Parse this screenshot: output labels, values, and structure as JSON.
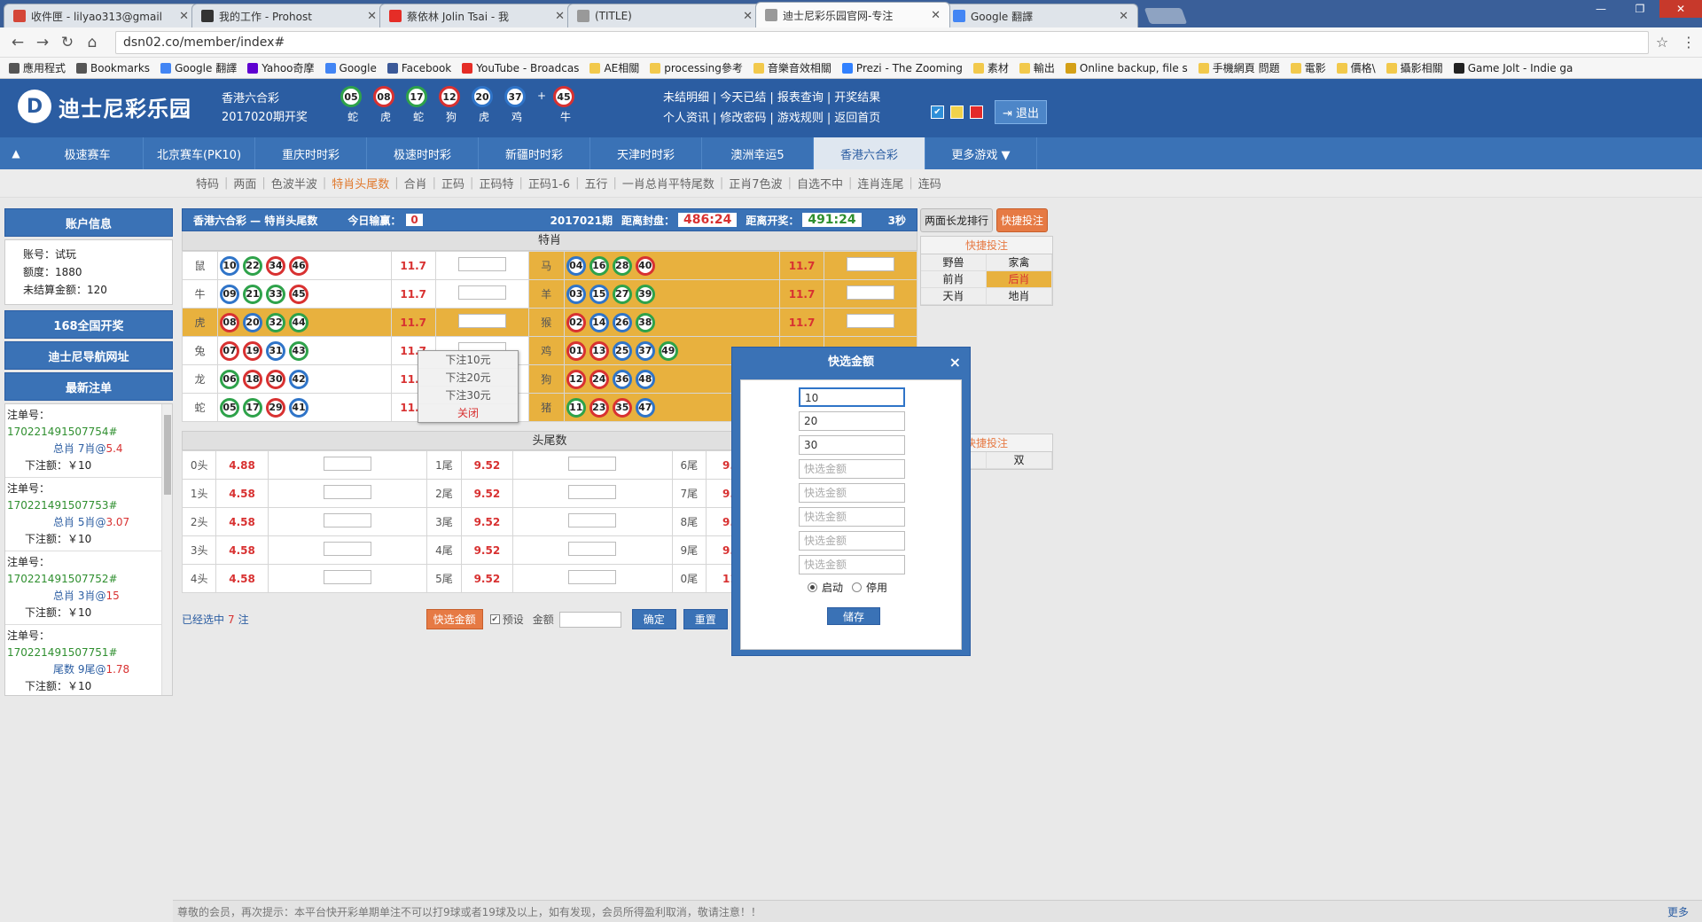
{
  "browser": {
    "tabs": [
      {
        "title": "收件匣 - lilyao313@gmail",
        "icon": "gmail-icon",
        "color": "#d44638",
        "active": false
      },
      {
        "title": "我的工作 - Prohost",
        "icon": "github-icon",
        "color": "#333333",
        "active": false
      },
      {
        "title": "蔡依林 Jolin Tsai - 我",
        "icon": "youtube-icon",
        "color": "#e52d27",
        "active": false
      },
      {
        "title": "(TITLE)",
        "icon": "page-icon",
        "color": "#999999",
        "active": false
      },
      {
        "title": "迪士尼彩乐园官网-专注",
        "icon": "page-icon",
        "color": "#999999",
        "active": true
      },
      {
        "title": "Google 翻譯",
        "icon": "google-translate-icon",
        "color": "#4285f4",
        "active": false
      }
    ],
    "url": "dsn02.co/member/index#",
    "bookmarks": [
      {
        "label": "應用程式",
        "icon": "apps-icon",
        "color": "#555555"
      },
      {
        "label": "Bookmarks",
        "icon": "star-icon",
        "color": "#555555"
      },
      {
        "label": "Google 翻譯",
        "icon": "google-translate-icon",
        "color": "#4285f4"
      },
      {
        "label": "Yahoo奇摩",
        "icon": "yahoo-icon",
        "color": "#5f01d1"
      },
      {
        "label": "Google",
        "icon": "google-icon",
        "color": "#4285f4"
      },
      {
        "label": "Facebook",
        "icon": "facebook-icon",
        "color": "#3b5998"
      },
      {
        "label": "YouTube - Broadcas",
        "icon": "youtube-icon",
        "color": "#e52d27"
      },
      {
        "label": "AE相關",
        "icon": "folder-icon",
        "color": "#f2c94c"
      },
      {
        "label": "processing參考",
        "icon": "folder-icon",
        "color": "#f2c94c"
      },
      {
        "label": "音樂音效相關",
        "icon": "folder-icon",
        "color": "#f2c94c"
      },
      {
        "label": "Prezi - The Zooming",
        "icon": "prezi-icon",
        "color": "#3181ff"
      },
      {
        "label": "素材",
        "icon": "folder-icon",
        "color": "#f2c94c"
      },
      {
        "label": "輸出",
        "icon": "folder-icon",
        "color": "#f2c94c"
      },
      {
        "label": "Online backup, file s",
        "icon": "backup-icon",
        "color": "#d4a017"
      },
      {
        "label": "手機網頁 問題",
        "icon": "folder-icon",
        "color": "#f2c94c"
      },
      {
        "label": "電影",
        "icon": "folder-icon",
        "color": "#f2c94c"
      },
      {
        "label": "價格\\",
        "icon": "folder-icon",
        "color": "#f2c94c"
      },
      {
        "label": "攝影相關",
        "icon": "folder-icon",
        "color": "#f2c94c"
      },
      {
        "label": "Game Jolt - Indie ga",
        "icon": "gamejolt-icon",
        "color": "#222222"
      }
    ]
  },
  "header": {
    "logo_letter": "D",
    "site_name": "迪士尼彩乐园",
    "lottery": "香港六合彩",
    "period_label": "2017020期开奖",
    "draw_balls": [
      {
        "num": "05",
        "zodiac": "蛇",
        "color": "green"
      },
      {
        "num": "08",
        "zodiac": "虎",
        "color": "red"
      },
      {
        "num": "17",
        "zodiac": "蛇",
        "color": "green"
      },
      {
        "num": "12",
        "zodiac": "狗",
        "color": "red"
      },
      {
        "num": "20",
        "zodiac": "虎",
        "color": "blue"
      },
      {
        "num": "37",
        "zodiac": "鸡",
        "color": "blue"
      }
    ],
    "plus": "+",
    "special_ball": {
      "num": "45",
      "zodiac": "牛",
      "color": "red"
    },
    "links_row1": [
      "未结明细",
      "今天已结",
      "报表查询",
      "开奖结果"
    ],
    "links_row2": [
      "个人资讯",
      "修改密码",
      "游戏规则",
      "返回首页"
    ],
    "link_sep": "|",
    "theme_colors": [
      "#2f8fd8",
      "#f2d24b",
      "#e32a2a"
    ],
    "logout": "退出"
  },
  "main_nav": {
    "toggle": "▲",
    "items": [
      "极速赛车",
      "北京赛车(PK10)",
      "重庆时时彩",
      "极速时时彩",
      "新疆时时彩",
      "天津时时彩",
      "澳洲幸运5",
      "香港六合彩",
      "更多游戏 ▼"
    ],
    "active_index": 7
  },
  "sub_nav": {
    "items": [
      "特码",
      "两面",
      "色波半波",
      "特肖头尾数",
      "合肖",
      "正码",
      "正码特",
      "正码1-6",
      "五行",
      "一肖总肖平特尾数",
      "正肖7色波",
      "自选不中",
      "连肖连尾",
      "连码"
    ],
    "active_index": 3,
    "sep": "|"
  },
  "sidebar": {
    "account_title": "账户信息",
    "account_lines": [
      "账号：试玩",
      "额度：1880",
      "未结算金额：120"
    ],
    "link1": "168全国开奖",
    "link2": "迪士尼导航网址",
    "recent_title": "最新注单",
    "bets": [
      {
        "label": "注单号：",
        "num": "170221491507754#",
        "detail": "总肖 7肖@",
        "odds": "5.4",
        "amount": "下注额：￥10"
      },
      {
        "label": "注单号：",
        "num": "170221491507753#",
        "detail": "总肖 5肖@",
        "odds": "3.07",
        "amount": "下注额：￥10"
      },
      {
        "label": "注单号：",
        "num": "170221491507752#",
        "detail": "总肖 3肖@",
        "odds": "15",
        "amount": "下注额：￥10"
      },
      {
        "label": "注单号：",
        "num": "170221491507751#",
        "detail": "尾数 9尾@",
        "odds": "1.78",
        "amount": "下注额：￥10"
      }
    ]
  },
  "content": {
    "title": "香港六合彩 — 特肖头尾数",
    "today_label": "今日输赢：",
    "today_value": "0",
    "period": "2017021期",
    "close_label": "距离封盘：",
    "close_time": "486:24",
    "open_label": "距离开奖：",
    "open_time": "491:24",
    "refresh": "3秒",
    "zodiac_header": "特肖",
    "zodiac_left": [
      {
        "name": "鼠",
        "balls": [
          [
            "10",
            "blue"
          ],
          [
            "22",
            "green"
          ],
          [
            "34",
            "red"
          ],
          [
            "46",
            "red"
          ]
        ],
        "odds": "11.7",
        "selected": false
      },
      {
        "name": "牛",
        "balls": [
          [
            "09",
            "blue"
          ],
          [
            "21",
            "green"
          ],
          [
            "33",
            "green"
          ],
          [
            "45",
            "red"
          ]
        ],
        "odds": "11.7",
        "selected": false
      },
      {
        "name": "虎",
        "balls": [
          [
            "08",
            "red"
          ],
          [
            "20",
            "blue"
          ],
          [
            "32",
            "green"
          ],
          [
            "44",
            "green"
          ]
        ],
        "odds": "11.7",
        "selected": true
      },
      {
        "name": "兔",
        "balls": [
          [
            "07",
            "red"
          ],
          [
            "19",
            "red"
          ],
          [
            "31",
            "blue"
          ],
          [
            "43",
            "green"
          ]
        ],
        "odds": "11.7",
        "selected": false
      },
      {
        "name": "龙",
        "balls": [
          [
            "06",
            "green"
          ],
          [
            "18",
            "red"
          ],
          [
            "30",
            "red"
          ],
          [
            "42",
            "blue"
          ]
        ],
        "odds": "11.7",
        "selected": false
      },
      {
        "name": "蛇",
        "balls": [
          [
            "05",
            "green"
          ],
          [
            "17",
            "green"
          ],
          [
            "29",
            "red"
          ],
          [
            "41",
            "blue"
          ]
        ],
        "odds": "11.7",
        "selected": false
      }
    ],
    "zodiac_right": [
      {
        "name": "马",
        "balls": [
          [
            "04",
            "blue"
          ],
          [
            "16",
            "green"
          ],
          [
            "28",
            "green"
          ],
          [
            "40",
            "red"
          ]
        ],
        "odds": "11.7"
      },
      {
        "name": "羊",
        "balls": [
          [
            "03",
            "blue"
          ],
          [
            "15",
            "blue"
          ],
          [
            "27",
            "green"
          ],
          [
            "39",
            "green"
          ]
        ],
        "odds": "11.7"
      },
      {
        "name": "猴",
        "balls": [
          [
            "02",
            "red"
          ],
          [
            "14",
            "blue"
          ],
          [
            "26",
            "blue"
          ],
          [
            "38",
            "green"
          ]
        ],
        "odds": "11.7"
      },
      {
        "name": "鸡",
        "balls": [
          [
            "01",
            "red"
          ],
          [
            "13",
            "red"
          ],
          [
            "25",
            "blue"
          ],
          [
            "37",
            "blue"
          ],
          [
            "49",
            "green"
          ]
        ],
        "odds": ""
      },
      {
        "name": "狗",
        "balls": [
          [
            "12",
            "red"
          ],
          [
            "24",
            "red"
          ],
          [
            "36",
            "blue"
          ],
          [
            "48",
            "blue"
          ]
        ],
        "odds": ""
      },
      {
        "name": "猪",
        "balls": [
          [
            "11",
            "green"
          ],
          [
            "23",
            "red"
          ],
          [
            "35",
            "red"
          ],
          [
            "47",
            "blue"
          ]
        ],
        "odds": ""
      }
    ],
    "tw_header": "头尾数",
    "tw_rows": [
      [
        {
          "l": "0头",
          "o": "4.88"
        },
        {
          "l": "1尾",
          "o": "9.52"
        },
        {
          "l": "6尾",
          "o": "9.5"
        }
      ],
      [
        {
          "l": "1头",
          "o": "4.58"
        },
        {
          "l": "2尾",
          "o": "9.52"
        },
        {
          "l": "7尾",
          "o": "9.5"
        }
      ],
      [
        {
          "l": "2头",
          "o": "4.58"
        },
        {
          "l": "3尾",
          "o": "9.52"
        },
        {
          "l": "8尾",
          "o": "9.5"
        }
      ],
      [
        {
          "l": "3头",
          "o": "4.58"
        },
        {
          "l": "4尾",
          "o": "9.52"
        },
        {
          "l": "9尾",
          "o": "9.5"
        }
      ],
      [
        {
          "l": "4头",
          "o": "4.58"
        },
        {
          "l": "5尾",
          "o": "9.52"
        },
        {
          "l": "0尾",
          "o": "11."
        }
      ]
    ],
    "selected_pre": "已经选中",
    "selected_count": "7",
    "selected_post": "注",
    "quick_btn": "快选金额",
    "preset_check": "✔",
    "preset_label": "预设",
    "amount_label": "金额",
    "confirm": "确定",
    "reset": "重置"
  },
  "dropdown": {
    "items": [
      "下注10元",
      "下注20元",
      "下注30元"
    ],
    "close": "关闭"
  },
  "right_panel": {
    "tab1": "两面长龙排行",
    "tab2": "快捷投注",
    "quick_title": "快捷投注",
    "rows": [
      [
        "野兽",
        "家禽"
      ],
      [
        "前肖",
        "后肖"
      ],
      [
        "天肖",
        "地肖"
      ]
    ],
    "active": "后肖",
    "quick_title2": "快捷投注",
    "row2_right": "双"
  },
  "modal": {
    "title": "快选金额",
    "close": "×",
    "values": [
      "10",
      "20",
      "30"
    ],
    "placeholder": "快选金额",
    "empty_count": 5,
    "enable": "启动",
    "disable": "停用",
    "save": "储存"
  },
  "footer": {
    "notice": "尊敬的会员，再次提示：本平台快开彩单期单注不可以打9球或者19球及以上，如有发现，会员所得盈利取消，敬请注意！！",
    "more": "更多"
  },
  "window_controls": [
    "—",
    "❐",
    "✕"
  ]
}
